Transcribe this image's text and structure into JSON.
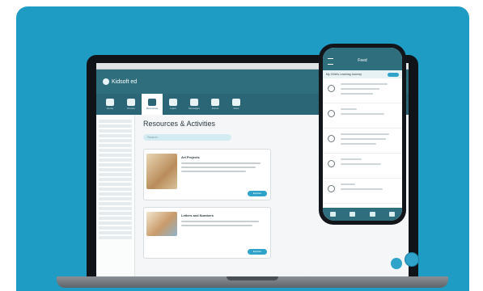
{
  "brand": {
    "name": "Kidsoft ed"
  },
  "toolbar": [
    {
      "label": "Home"
    },
    {
      "label": "Rooms"
    },
    {
      "label": "Resources",
      "active": true
    },
    {
      "label": "Learn"
    },
    {
      "label": "Messages"
    },
    {
      "label": "Forms"
    },
    {
      "label": "Docs"
    }
  ],
  "page": {
    "title": "Resources & Activities",
    "search_placeholder": "Search"
  },
  "resources": [
    {
      "title": "Art Projects",
      "button": "Explore"
    },
    {
      "title": "Letters and Numbers",
      "button": "Explore"
    }
  ],
  "mobile": {
    "title": "Feed",
    "subtitle": "My Child's Learning Journey"
  },
  "colors": {
    "background": "#1f9cc4",
    "brand": "#2f6f7d",
    "accent": "#2fa3c9"
  }
}
